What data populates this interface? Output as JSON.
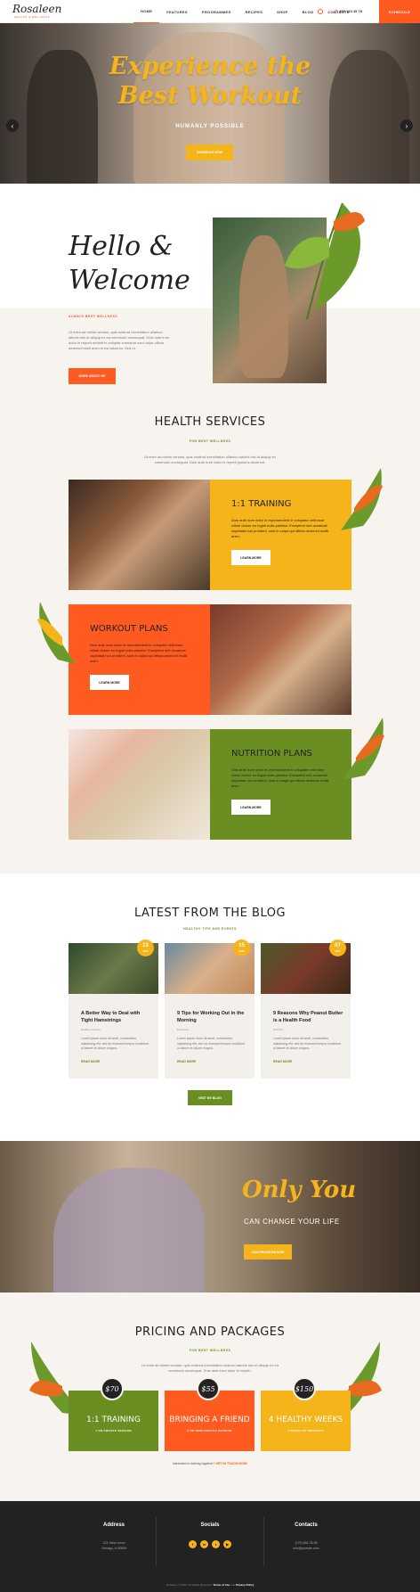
{
  "header": {
    "logo": "Rosaleen",
    "logo_sub": "HEALTH & WELLNESS",
    "nav": [
      "HOME",
      "FEATURES",
      "PROGRAMMES",
      "RECIPES",
      "SHOP",
      "BLOG",
      "CONTACTS"
    ],
    "phone": "800 123 45 78",
    "schedule": "SCHEDULE"
  },
  "hero": {
    "title_line1": "Experience the",
    "title_line2": "Best Workout",
    "subtitle": "HUMANLY POSSIBLE",
    "button": "SCHEDULE NOW"
  },
  "welcome": {
    "title_line1": "Hello &",
    "title_line2": "Welcome",
    "kicker": "ALWAYS BEST WELLNESS",
    "text": "Ut enim ad minim veniam, quis nostrud exercitation ullamco laboris nisi ut aliquip ex ea commodo consequat. Duis aute irure dolor in repreh enderit in voluptat evenarint sunt culpa officia deserunt molli anim id est laborum. Sed ut.",
    "button": "MORE ABOUT ME"
  },
  "services": {
    "title": "HEALTH SERVICES",
    "subtitle": "FOR BEST WELLNESS",
    "description": "Ut enim ad minim veniam, quis nostrud exercitation ullamco laboris nisi ut aliquip ex commodo consequat. Duis aute irure dolor in repreh ipsilons deserunt.",
    "items": [
      {
        "title": "1:1 TRAINING",
        "text": "Duis aute irure dolor in reprehenderit in voluptate velit esse cillum dolore eu fugiat nulla pariatur. Excepteur sint occaecat cupidatat non proident, sunt in culpa qui officia deserunt mollit anim.",
        "button": "LEARN MORE"
      },
      {
        "title": "WORKOUT PLANS",
        "text": "Duis aute irure dolor in reprehenderit in voluptate velit esse cillum dolore eu fugiat nulla pariatur. Excepteur sint occaecat cupidatat non proident, sunt in culpa qui officia deserunt mollit anim.",
        "button": "LEARN MORE"
      },
      {
        "title": "NUTRITION PLANS",
        "text": "Duis aute irure dolor in reprehenderit in voluptate velit esse cillum dolore eu fugiat nulla pariatur. Excepteur sint occaecat cupidatat non proident, sunt in culpa qui officia deserunt mollit anim.",
        "button": "LEARN MORE"
      }
    ]
  },
  "blog": {
    "title": "LATEST FROM THE BLOG",
    "subtitle": "HEALTHY TIPS AND EVENTS",
    "posts": [
      {
        "day": "13",
        "month": "JUN",
        "title": "A Better Way to Deal with Tight Hamstrings",
        "meta": "Healthy Lifestyle",
        "text": "Lorem ipsum dolor sit amet, consectetur adipisicing elit, sed do eiusmod tempor incididunt ut labore et dolore magna.",
        "more": "READ MORE"
      },
      {
        "day": "15",
        "month": "JUN",
        "title": "9 Tips for Working Out in the Morning",
        "meta": "Exercises",
        "text": "Lorem ipsum dolor sit amet, consectetur adipisicing elit, sed do eiusmod tempor incididunt ut labore et dolore magna.",
        "more": "READ MORE"
      },
      {
        "day": "07",
        "month": "JUN",
        "title": "9 Reasons Why Peanut Butter is a Health Food",
        "meta": "Nutrition",
        "text": "Lorem ipsum dolor sit amet, consectetur adipisicing elit, sed do eiusmod tempor incididunt ut labore et dolore magna.",
        "more": "READ MORE"
      }
    ],
    "button": "VISIT MY BLOG"
  },
  "only_you": {
    "title": "Only You",
    "subtitle": "CAN CHANGE YOUR LIFE",
    "button": "JOIN PROGRAM NOW"
  },
  "pricing": {
    "title": "PRICING AND PACKAGES",
    "subtitle": "FOR BEST WELLNESS",
    "description": "Ut enim ad minim veniam, quis nostrud exercitation ullamco laboris nisi ut aliquip ex ea commodo consequat. Duis aute irure dolor in repreh.",
    "plans": [
      {
        "price": "$70",
        "name": "1:1 TRAINING",
        "sub": "1 ON PRIVATE SESSION",
        "color": "#6b8e23"
      },
      {
        "price": "$55",
        "name": "BRINGING A FRIEND",
        "sub": "2 ON SEMI PRIVATE SESSION",
        "color": "#ff5a1f"
      },
      {
        "price": "$150",
        "name": "4 HEALTHY WEEKS",
        "sub": "1 MONTH OF WORKOUT",
        "color": "#f5b51a"
      }
    ],
    "note_text": "Interested in training together?",
    "note_link": "GET IN TOUCH NOW!"
  },
  "footer": {
    "address_head": "Address",
    "address": [
      "123, New Lenox",
      "Chicago, IL 60606"
    ],
    "socials_head": "Socials",
    "socials": [
      "f",
      "in",
      "t",
      "▶"
    ],
    "contacts_head": "Contacts",
    "contacts": [
      "(175) 634-78-95",
      "info@yoursite.com"
    ],
    "copyright_pre": "Rosaleen © 2019. All Rights Reserved.",
    "terms": "Terms of Use",
    "and": "and",
    "privacy": "Privacy Policy"
  },
  "colors": {
    "orange": "#ff5a1f",
    "yellow": "#f5b51a",
    "green": "#6b8e23",
    "dark": "#222222"
  }
}
